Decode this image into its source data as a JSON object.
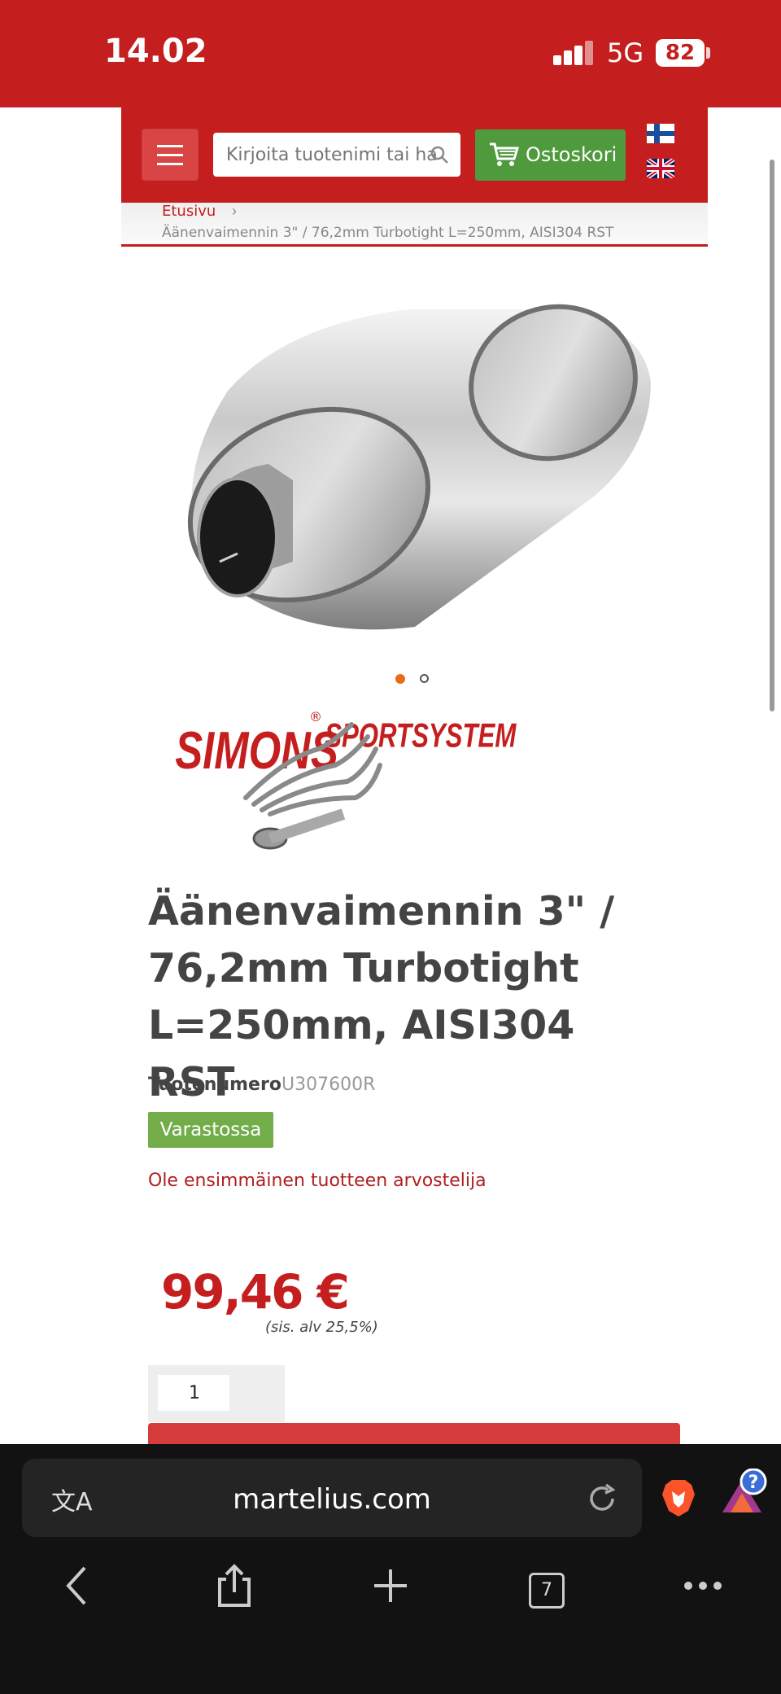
{
  "status_bar": {
    "time": "14.02",
    "network": "5G",
    "battery": "82"
  },
  "header": {
    "search_placeholder": "Kirjoita tuotenimi tai hakusana",
    "cart_label": "Ostoskori"
  },
  "breadcrumb": {
    "home": "Etusivu",
    "separator": "›",
    "current": "Äänenvaimennin 3\" / 76,2mm Turbotight L=250mm, AISI304 RST"
  },
  "brand": {
    "name": "SIMONS",
    "sub": "SPORTSYSTEM",
    "registered": "®"
  },
  "product": {
    "title": "Äänenvaimennin 3\" / 76,2mm Turbotight L=250mm, AISI304 RST",
    "sku_label": "Tuotenumero",
    "sku": "U307600R",
    "stock_status": "Varastossa",
    "review_link": "Ole ensimmäinen tuotteen arvostelija",
    "price": "99,46 €",
    "vat_note": "(sis. alv 25,5%)",
    "quantity": "1"
  },
  "gallery": {
    "image_count": 2,
    "active_index": 1
  },
  "browser": {
    "url": "martelius.com",
    "tabs_count": "7",
    "rewards_badge": "?"
  },
  "colors": {
    "brand_red": "#c41f1e",
    "cart_green": "#4e9a3c",
    "stock_green": "#72ad49",
    "active_dot": "#e86b1b"
  }
}
